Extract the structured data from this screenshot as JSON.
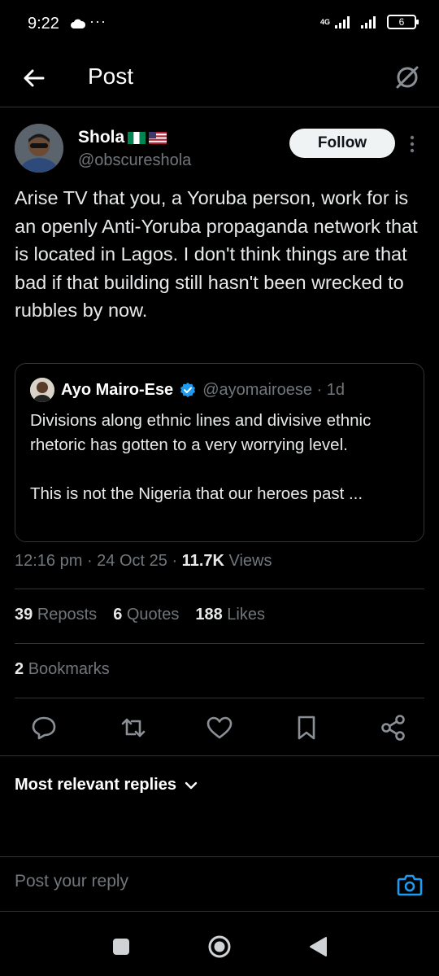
{
  "status_bar": {
    "time": "9:22",
    "dots": "···",
    "network": "4G",
    "battery": "6"
  },
  "topbar": {
    "title": "Post",
    "back_icon": "arrow-left-icon",
    "grok_icon": "grok-icon"
  },
  "post": {
    "author_name": "Shola",
    "author_handle": "@obscureshola",
    "follow_label": "Follow",
    "text": "Arise TV that you, a Yoruba person, work for is an openly Anti-Yoruba propaganda network that is located in Lagos. I don't think things are that bad if that building still hasn't been wrecked to rubbles by now.",
    "quote": {
      "name": "Ayo Mairo-Ese",
      "handle": "@ayomairoese · 1d",
      "text": "Divisions along ethnic lines and divisive ethnic rhetoric has gotten to a very worrying level.\n\nThis is not the Nigeria that our heroes past ..."
    },
    "time": "12:16 pm",
    "date": "24 Oct 25",
    "views_count": "11.7K",
    "views_label": "Views",
    "reposts_count": "39",
    "reposts_label": "Reposts",
    "quotes_count": "6",
    "quotes_label": "Quotes",
    "likes_count": "188",
    "likes_label": "Likes",
    "bookmarks_count": "2",
    "bookmarks_label": "Bookmarks"
  },
  "sort_label": "Most relevant replies",
  "reply_placeholder": "Post your reply",
  "colors": {
    "accent": "#1d9bf0",
    "border": "#2f3336",
    "muted": "#71767b",
    "text": "#e7e9ea"
  }
}
